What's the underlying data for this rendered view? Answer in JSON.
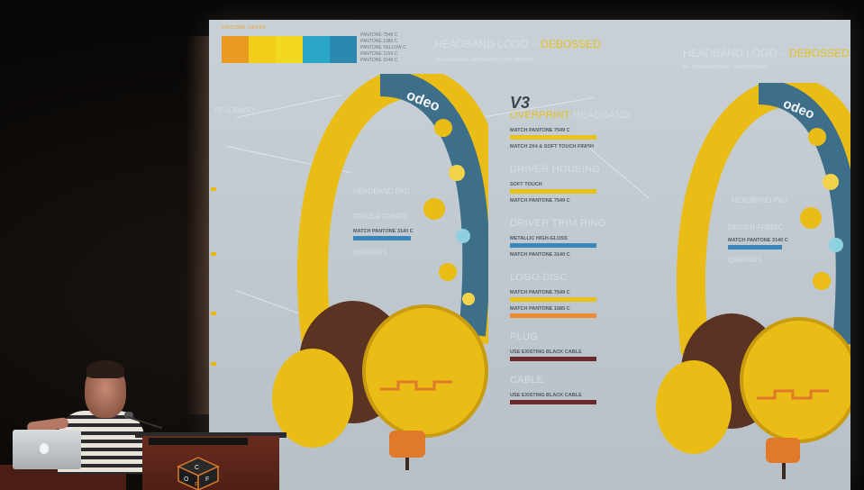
{
  "slide": {
    "palette_label": "PANTONE ORDER",
    "swatch_colors": [
      "#e89a22",
      "#f2cd1a",
      "#f2d81e",
      "#2aa6c8",
      "#2b89b0"
    ],
    "pantone_lines": [
      "PANTONE 7549 C",
      "PANTONE 1385 C",
      "PANTONE YELLOW C",
      "PANTONE 3155 C",
      "PANTONE 3140 C"
    ],
    "title_left": {
      "text": "HEADBAND LOGO",
      "highlight": "DEBOSSED"
    },
    "subtitle_left": "ON A SEPARATE LAYER WITH LOGO PRINTED",
    "title_right": {
      "text": "HEADBAND LOGO",
      "highlight": "DEBOSSED"
    },
    "subtitle_right": "ALL SCREENED PRINT ON OVERPRINT",
    "version": "V3",
    "headband_brand": "odeo",
    "sections": [
      {
        "title": "OVERPRINT",
        "title_suffix": "HEADBAND",
        "highlight": true,
        "specs": [
          "MATCH PANTONE 7549 C",
          "MATCH 2X4 & SOFT TOUCH FINISH"
        ],
        "bar_colors": [
          "#e8c21c"
        ]
      },
      {
        "title": "DRIVER HOUSING",
        "specs": [
          "SOFT TOUCH",
          "MATCH PANTONE 7549 C"
        ],
        "bar_colors": [
          "#e8c21c"
        ]
      },
      {
        "title": "DRIVER TRIM RING",
        "specs": [
          "METALLIC HIGH-GLOSS",
          "MATCH PANTONE 3140 C"
        ],
        "bar_colors": [
          "#3a86b8"
        ]
      },
      {
        "title": "LOGO DISC",
        "specs": [
          "MATCH PANTONE 7549 C",
          "MATCH PANTONE 1585 C"
        ],
        "bar_colors": [
          "#e8c21c",
          "#ef8a33"
        ]
      },
      {
        "title": "PLUG",
        "specs": [
          "USE EXISTING BLACK CABLE"
        ],
        "bar_colors": [
          "#6b2a2a"
        ]
      },
      {
        "title": "CABLE",
        "specs": [
          "USE EXISTING BLACK CABLE"
        ],
        "bar_colors": [
          "#6b2a2a"
        ]
      }
    ],
    "callouts_left": {
      "headband": "HEADBAND",
      "headband_pad": "HEADBAND PAD",
      "driver_fabric": "DRIVER FABRIC",
      "driver_fabric_spec": "MATCH PANTONE 3140 C",
      "earpads": "EARPADS"
    },
    "callouts_right": {
      "headband_pad": "HEADBAND PAD",
      "driver_fabric": "DRIVER FABRIC",
      "driver_fabric_spec": "MATCH PANTONE 3140 C",
      "earpads": "EARPADS"
    }
  },
  "scene": {
    "podium_logo_letters": [
      "C",
      "O",
      "F",
      "F"
    ],
    "colors": {
      "headphone_yellow": "#e9bd16",
      "headband_pattern": "#3d6e8a",
      "earpad_brown": "#5a3322",
      "logo_orange": "#e07a2a"
    }
  }
}
